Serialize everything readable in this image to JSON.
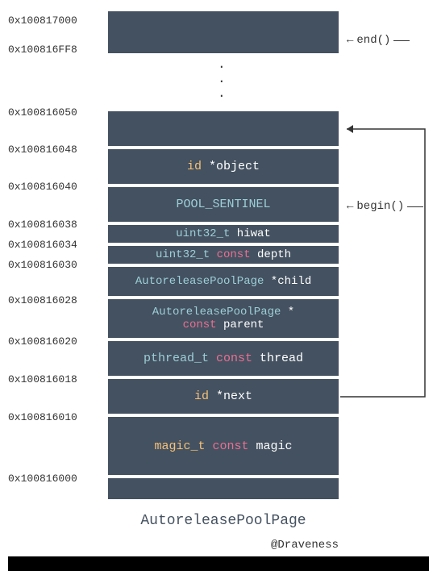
{
  "addresses": {
    "a0": "0x100817000",
    "a1": "0x100816FF8",
    "a2": "0x100816050",
    "a3": "0x100816048",
    "a4": "0x100816040",
    "a5": "0x100816038",
    "a6": "0x100816034",
    "a7": "0x100816030",
    "a8": "0x100816028",
    "a9": "0x100816020",
    "a10": "0x100816018",
    "a11": "0x100816010",
    "a12": "0x100816000"
  },
  "cells": {
    "object_id": "id",
    "object_star": " *object",
    "sentinel": "POOL_SENTINEL",
    "hiwat_type": "uint32_t",
    "hiwat_name": " hiwat",
    "depth_type": "uint32_t",
    "depth_const": " const",
    "depth_name": " depth",
    "child_type": "AutoreleasePoolPage",
    "child_name": " *child",
    "parent_type": "AutoreleasePoolPage",
    "parent_star": " *",
    "parent_const": "const",
    "parent_name": " parent",
    "thread_type": "pthread_t",
    "thread_const": " const",
    "thread_name": " thread",
    "next_id": "id",
    "next_name": " *next",
    "magic_type": "magic_t",
    "magic_const": " const",
    "magic_name": " magic",
    "title": "AutoreleasePoolPage"
  },
  "labels": {
    "end": "end()",
    "begin": "begin()",
    "attribution": "@Draveness"
  },
  "dots": "·"
}
